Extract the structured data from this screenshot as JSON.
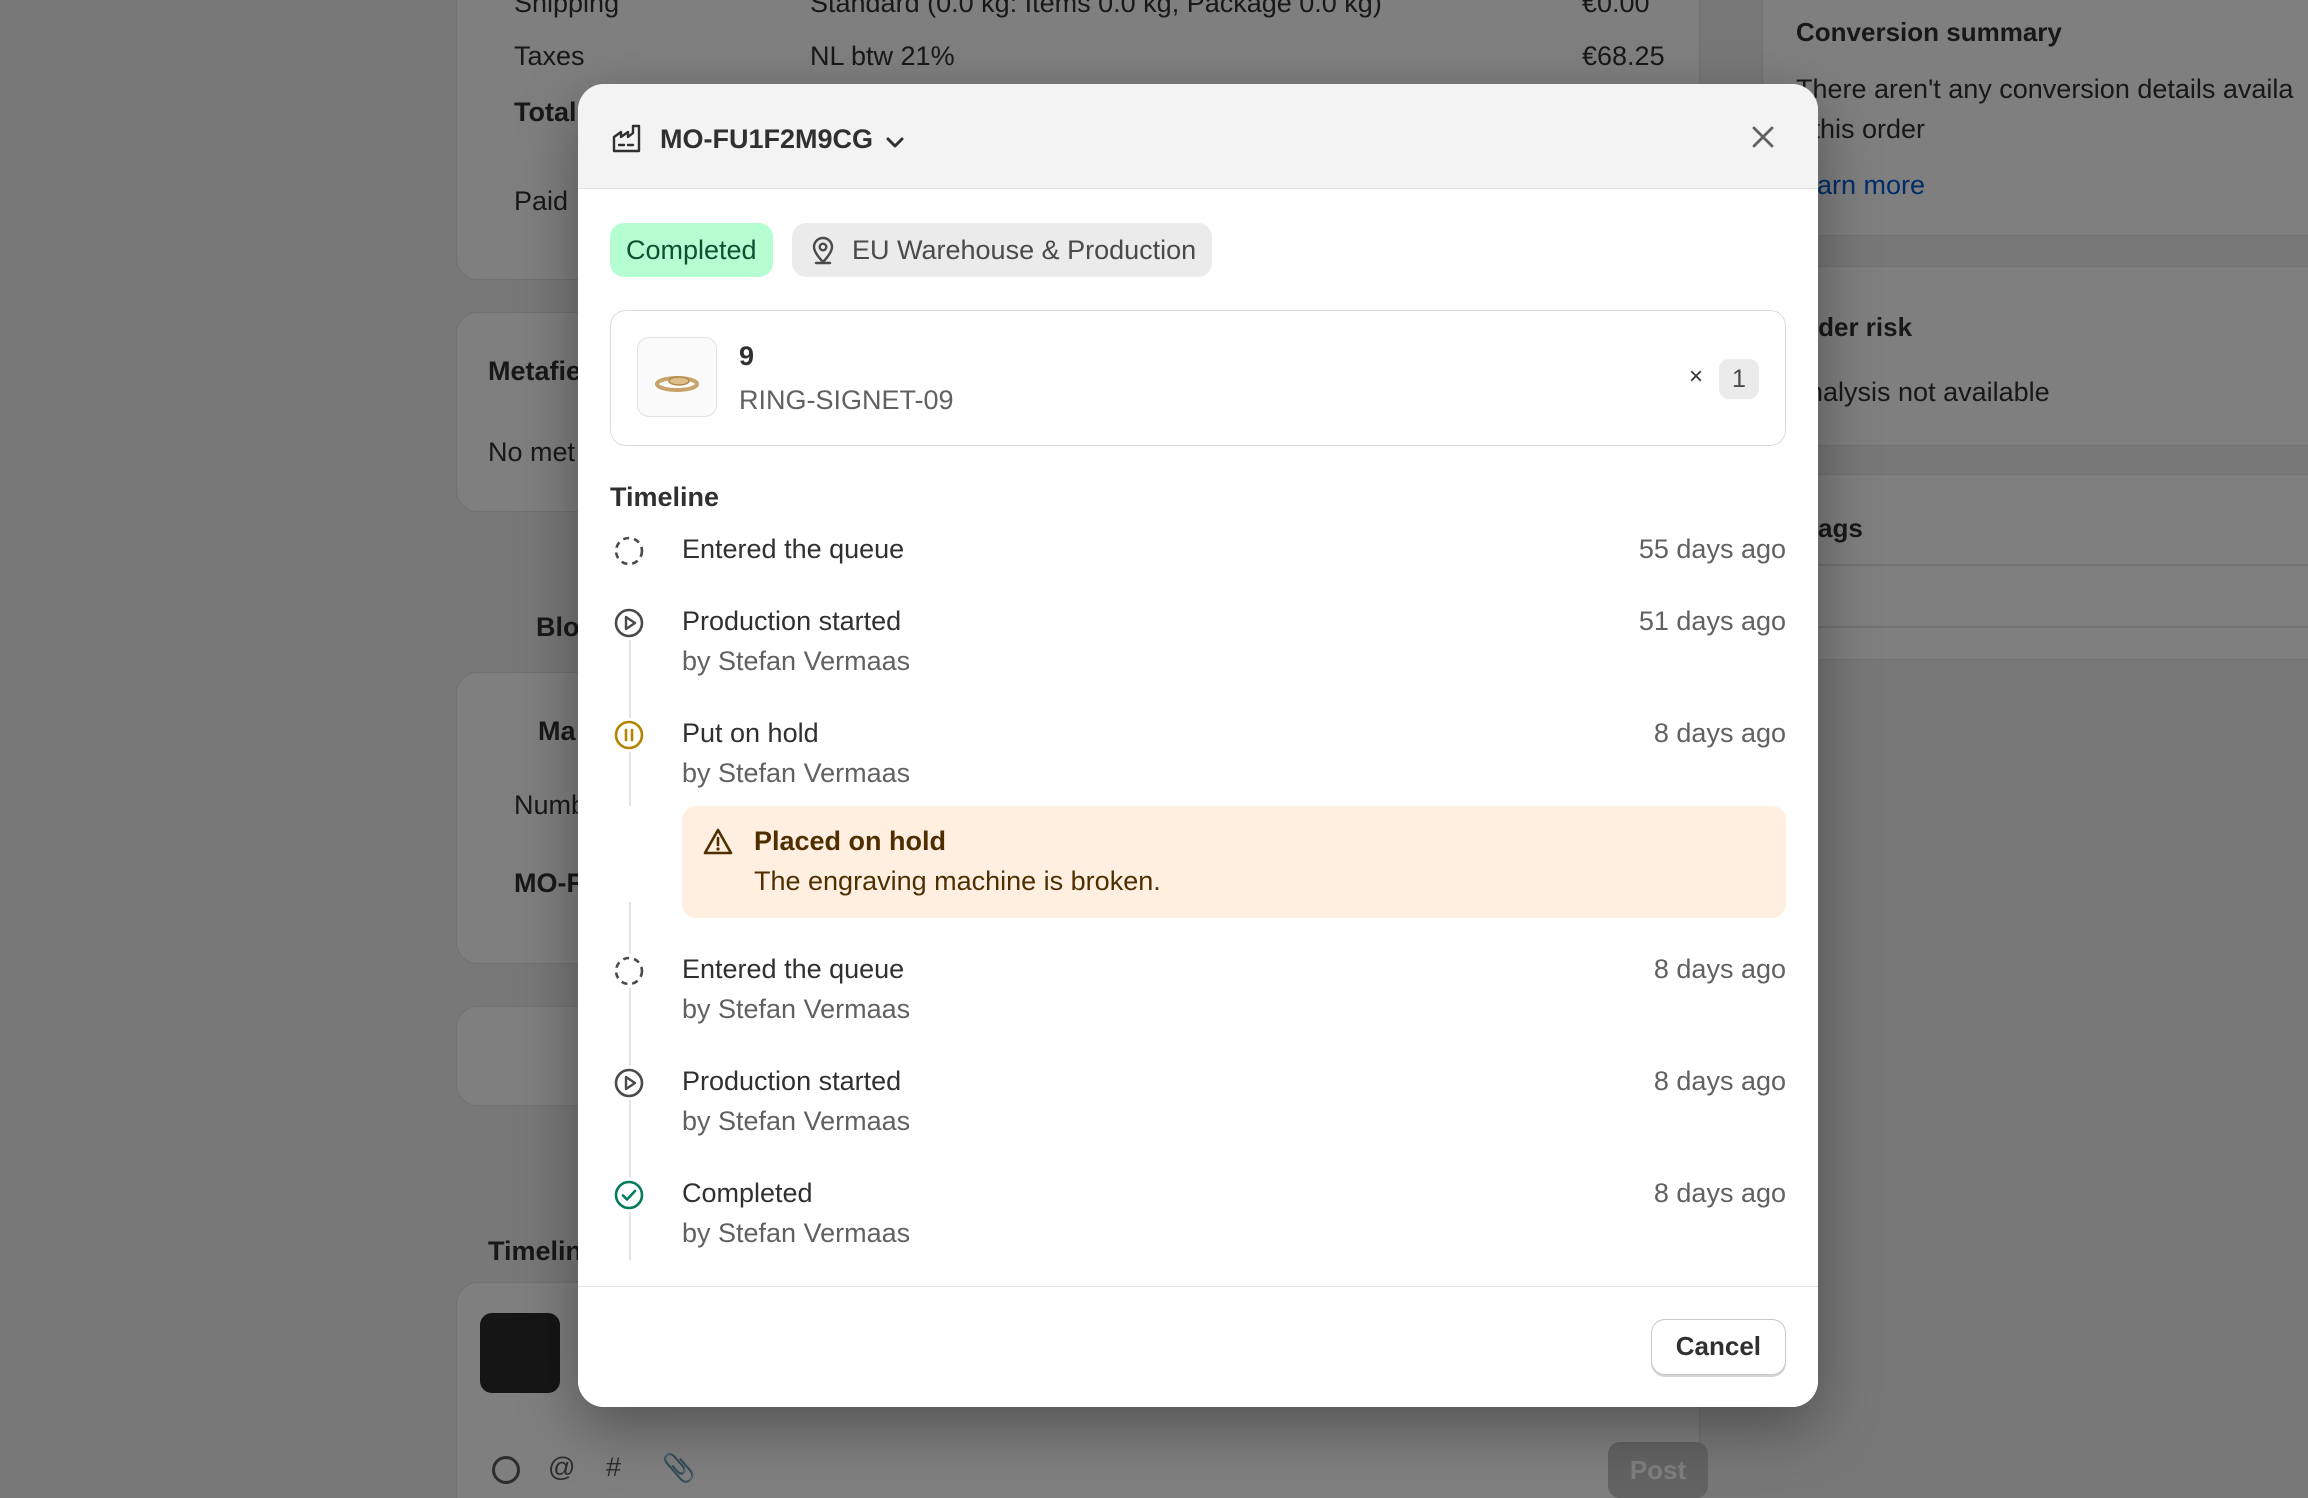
{
  "background": {
    "shipping_label": "Shipping",
    "shipping_desc": "Standard (0.0 kg: Items 0.0 kg, Package 0.0 kg)",
    "shipping_amount": "€0.00",
    "taxes_label": "Taxes",
    "taxes_desc": "NL btw 21%",
    "taxes_amount": "€68.25",
    "total_label": "Total",
    "paid_label": "Paid",
    "metafields_title": "Metafie",
    "metafields_empty": "No met",
    "blocks_title": "Blo",
    "mo_section_title": "Ma",
    "mo_table_header": "Numb",
    "mo_row": "MO-F",
    "timeline_title": "Timelin",
    "post_button": "Post",
    "conversion_title": "Conversion summary",
    "conversion_text_1": "There aren't any conversion details availa",
    "conversion_text_2": "r this order",
    "learn_more": "earn more",
    "order_risk_title": "rder risk",
    "order_risk_text": "nalysis not available",
    "tags_title": "ags"
  },
  "modal": {
    "title": "MO-FU1F2M9CG",
    "status_badge": "Completed",
    "location_badge": "EU Warehouse & Production",
    "item": {
      "name": "9",
      "sku": "RING-SIGNET-09",
      "times": "×",
      "quantity": "1"
    },
    "timeline_title": "Timeline",
    "events": [
      {
        "label": "Entered the queue",
        "by": "",
        "time": "55 days ago",
        "icon": "queue-icon"
      },
      {
        "label": "Production started",
        "by": "by Stefan Vermaas",
        "time": "51 days ago",
        "icon": "play-icon"
      },
      {
        "label": "Put on hold",
        "by": "by Stefan Vermaas",
        "time": "8 days ago",
        "icon": "pause-icon"
      },
      {
        "label": "Entered the queue",
        "by": "by Stefan Vermaas",
        "time": "8 days ago",
        "icon": "queue-icon"
      },
      {
        "label": "Production started",
        "by": "by Stefan Vermaas",
        "time": "8 days ago",
        "icon": "play-icon"
      },
      {
        "label": "Completed",
        "by": "by Stefan Vermaas",
        "time": "8 days ago",
        "icon": "check-circle-icon"
      }
    ],
    "hold_notice": {
      "title": "Placed on hold",
      "description": "The engraving machine is broken."
    },
    "cancel_button": "Cancel"
  },
  "colors": {
    "completed_badge_bg": "#b4fed2",
    "completed_badge_text": "#0c5132",
    "hold_icon": "#b28400",
    "check_icon": "#047b5d",
    "notice_bg": "#ffefe0",
    "link": "#005bd3"
  }
}
